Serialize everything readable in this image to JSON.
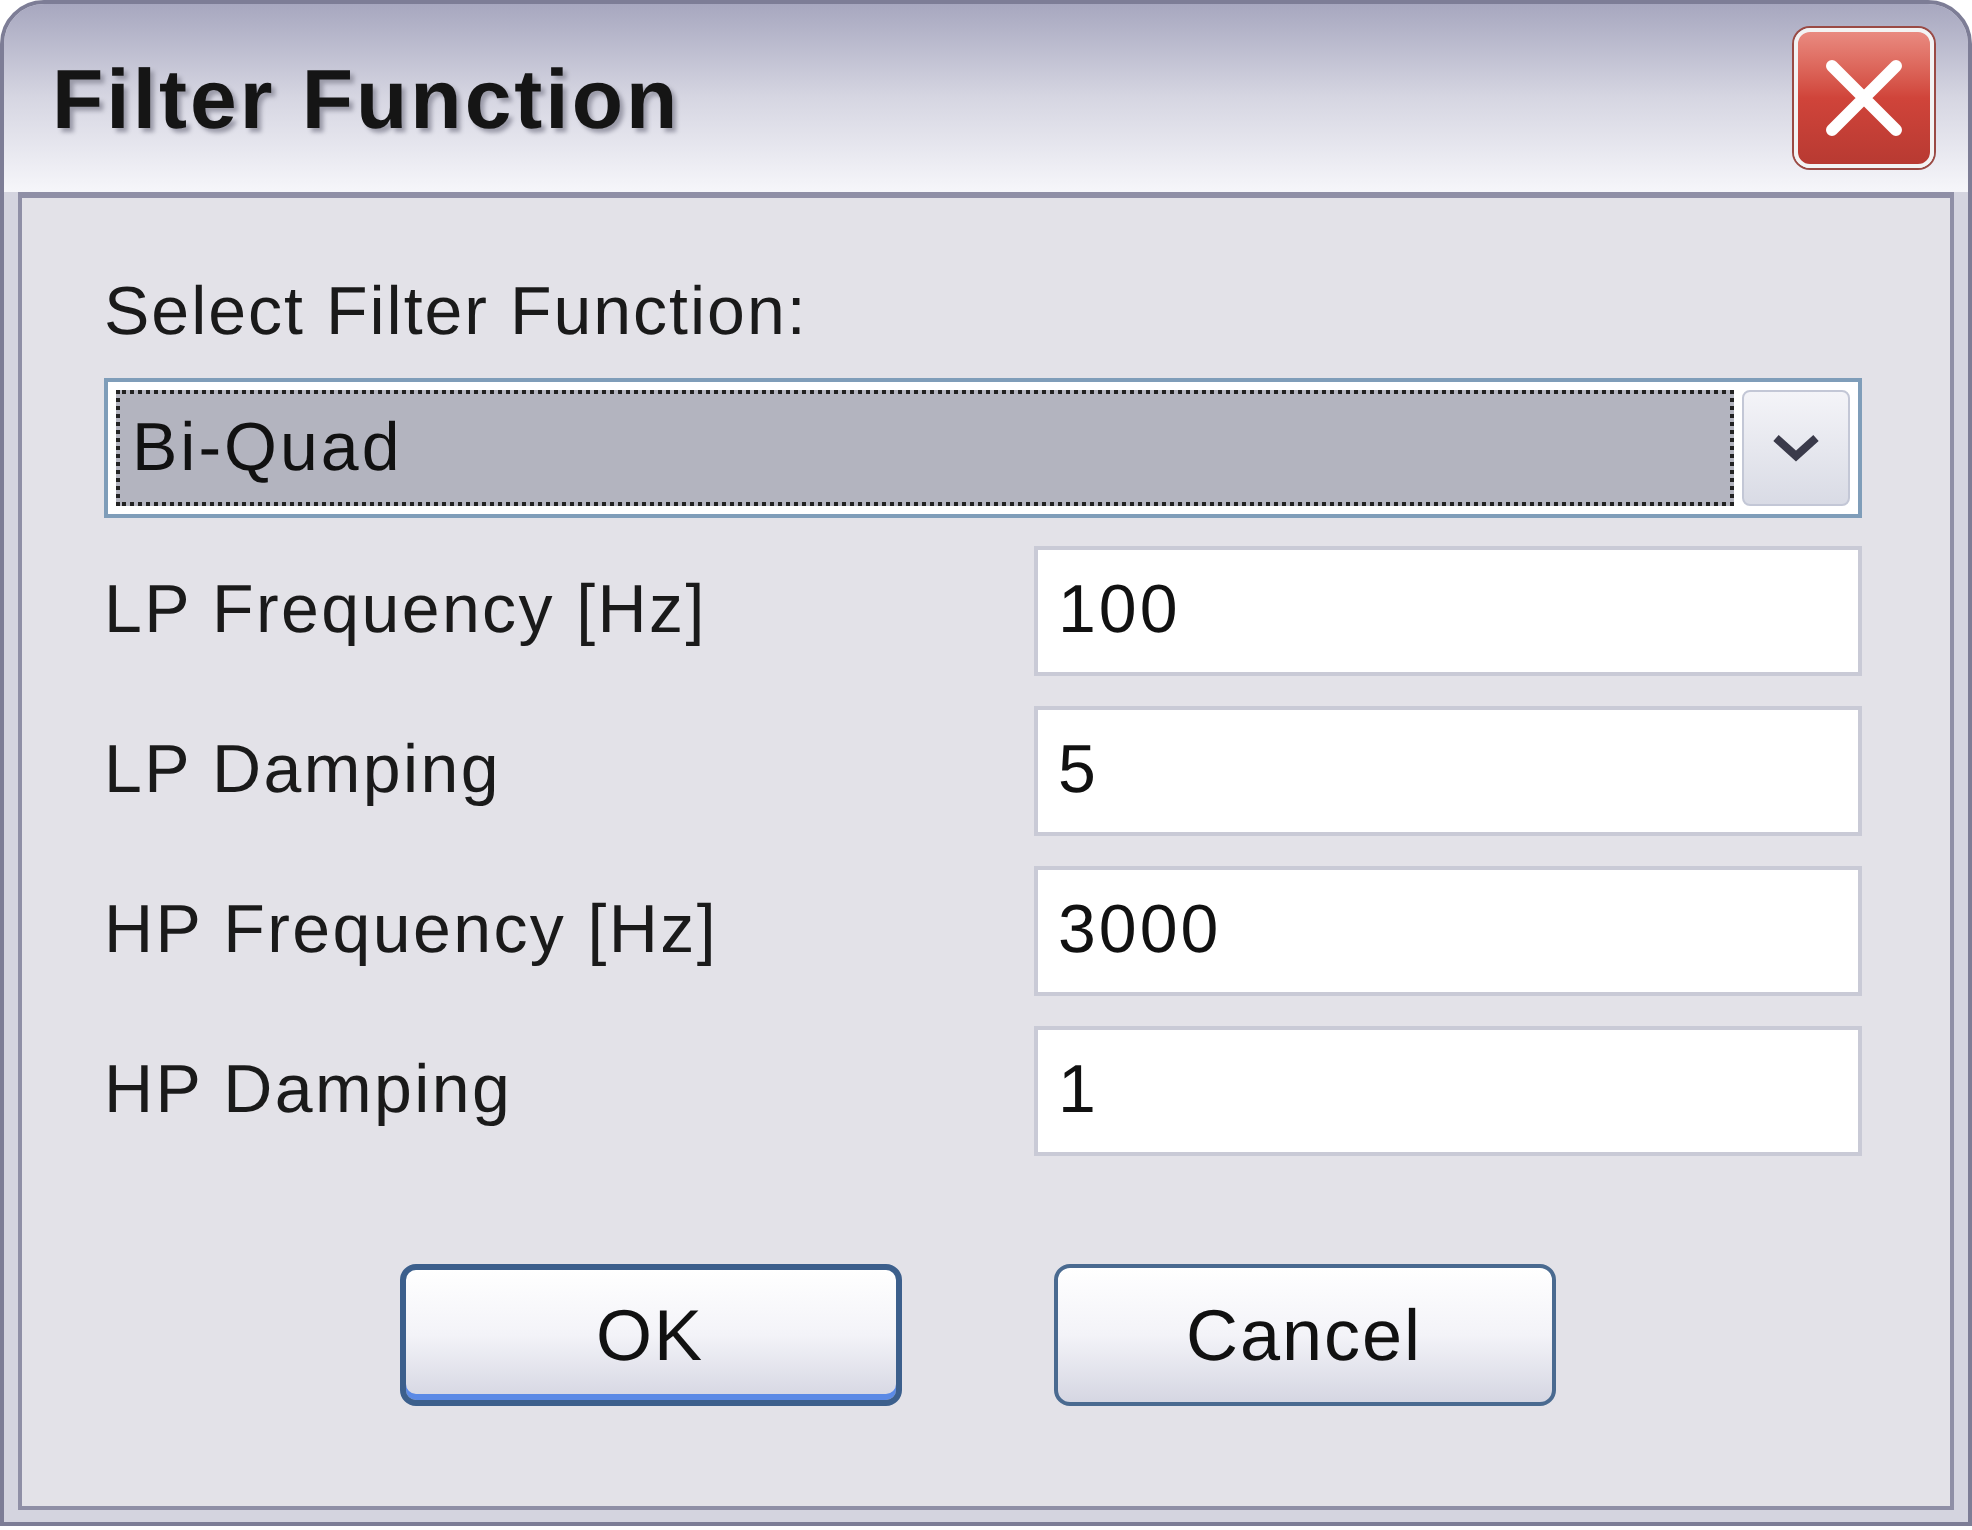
{
  "window": {
    "title": "Filter Function"
  },
  "filter_select": {
    "label": "Select Filter Function:",
    "value": "Bi-Quad",
    "focused": true
  },
  "fields": [
    {
      "label": "LP Frequency [Hz]",
      "value": "100"
    },
    {
      "label": "LP Damping",
      "value": "5"
    },
    {
      "label": "HP Frequency [Hz]",
      "value": "3000"
    },
    {
      "label": "HP Damping",
      "value": "1"
    }
  ],
  "buttons": [
    {
      "label": "OK",
      "default": true
    },
    {
      "label": "Cancel",
      "default": false
    }
  ]
}
